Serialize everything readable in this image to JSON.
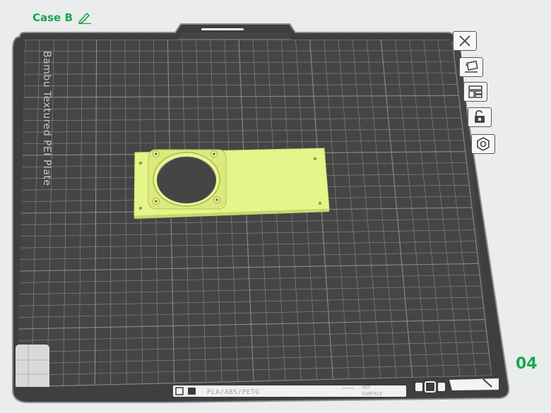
{
  "plate": {
    "name": "Case B",
    "number": "04",
    "bed_label": "Bambu Textured PEI Plate"
  },
  "bottom_bar": {
    "filament_text": "PLA/ABS/PETG",
    "hot_label_1": "HOT",
    "hot_label_2": "SURFACE"
  },
  "side_toolbar": [
    {
      "name": "close-icon"
    },
    {
      "name": "auto-orient-icon"
    },
    {
      "name": "arrange-icon"
    },
    {
      "name": "lock-icon"
    },
    {
      "name": "settings-icon"
    }
  ],
  "colors": {
    "accent": "#18a84c",
    "bed": "#444444",
    "grid": "#8c8c8c",
    "model": "#e6f58a"
  }
}
